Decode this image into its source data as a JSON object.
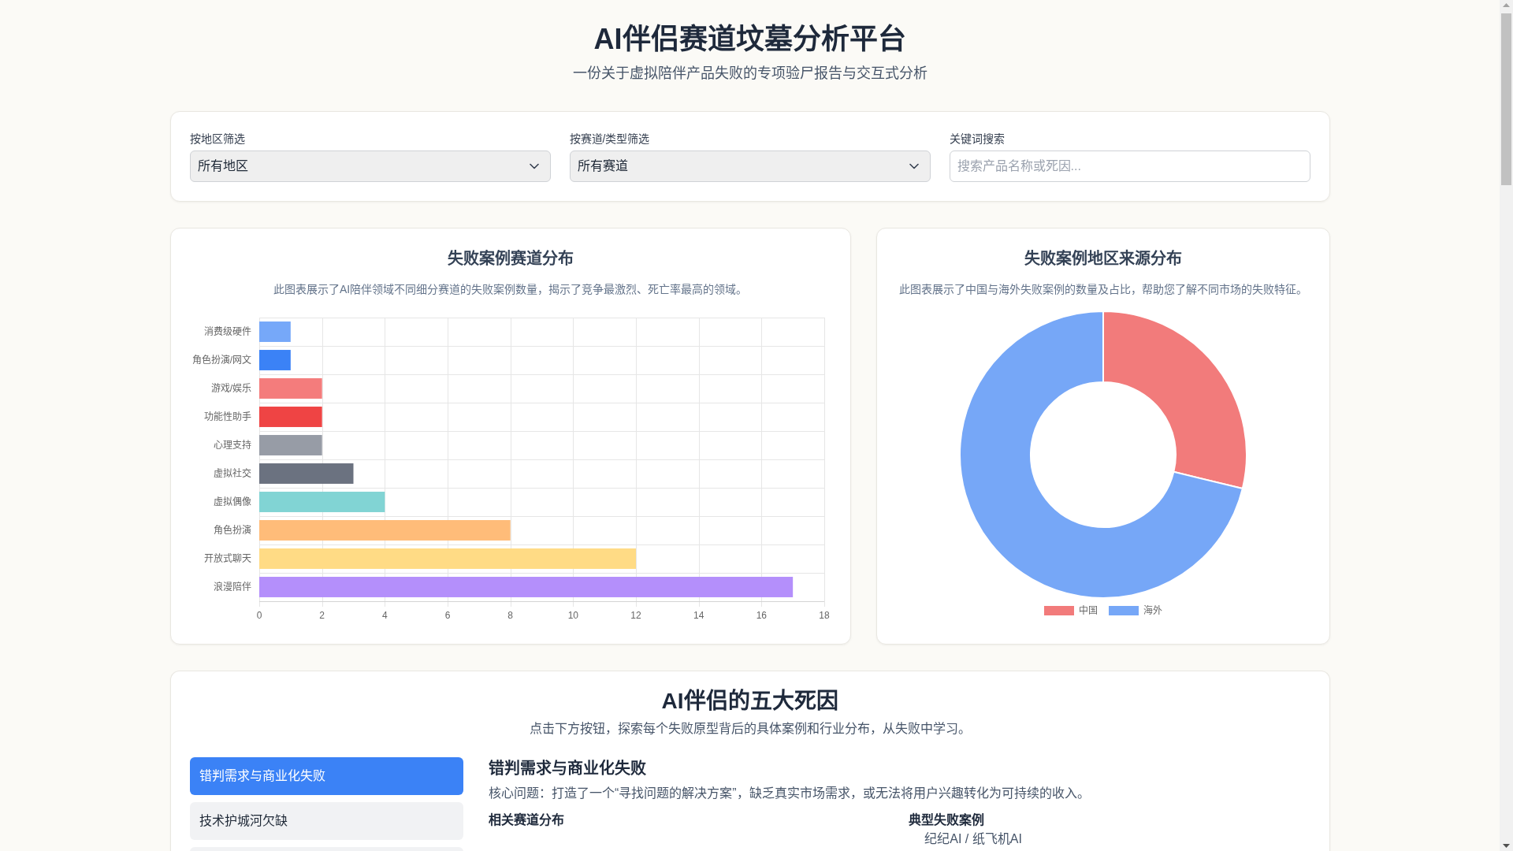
{
  "header": {
    "title": "AI伴侣赛道坟墓分析平台",
    "subtitle": "一份关于虚拟陪伴产品失败的专项验尸报告与交互式分析"
  },
  "filters": [
    {
      "kind": "dropdown",
      "label": "按地区筛选",
      "value": "所有地区"
    },
    {
      "kind": "dropdown",
      "label": "按赛道/类型筛选",
      "value": "所有赛道"
    },
    {
      "kind": "search",
      "label": "关键词搜索",
      "placeholder": "搜索产品名称或死因..."
    }
  ],
  "track_chart": {
    "title": "失败案例赛道分布",
    "description": "此图表展示了AI陪伴领域不同细分赛道的失败案例数量，揭示了竞争最激烈、死亡率最高的领域。",
    "chart_data": {
      "type": "bar",
      "orientation": "horizontal",
      "grid": true,
      "categories": [
        "消费级硬件",
        "角色扮演/网文",
        "游戏/娱乐",
        "功能性助手",
        "心理支持",
        "虚拟社交",
        "虚拟偶像",
        "角色扮演",
        "开放式聊天",
        "浪漫陪伴"
      ],
      "values": [
        1,
        1,
        2,
        2,
        2,
        3,
        4,
        8,
        12,
        17
      ],
      "colors": [
        "#76a8f9",
        "#3b82f6",
        "#f47c7c",
        "#ef4444",
        "#979ca6",
        "#6b7280",
        "#81d4d4",
        "#ffbc79",
        "#ffdb85",
        "#b48ffb"
      ],
      "xlim": [
        0,
        18
      ],
      "xticks": [
        0,
        2,
        4,
        6,
        8,
        10,
        12,
        14,
        16,
        18
      ]
    }
  },
  "region_chart": {
    "title": "失败案例地区来源分布",
    "description": "此图表展示了中国与海外失败案例的数量及占比，帮助您了解不同市场的失败特征。",
    "legend": [
      {
        "label": "中国",
        "color": "#f27b7b"
      },
      {
        "label": "海外",
        "color": "#76a7f7"
      }
    ]
  },
  "causes": {
    "title": "AI伴侣的五大死因",
    "subtitle": "点击下方按钮，探索每个失败原型背后的具体案例和行业分布，从失败中学习。",
    "tabs": [
      {
        "label": "错判需求与商业化失败",
        "selected": true
      },
      {
        "label": "技术护城河欠缺",
        "selected": false
      },
      {
        "selected": false
      }
    ],
    "detail": {
      "title": "错判需求与商业化失败",
      "summary": "核心问题：打造了一个“寻找问题的解决方案”，缺乏真实市场需求，或无法将用户兴趣转化为可持续的收入。",
      "sections": [
        {
          "title": "相关赛道分布"
        },
        {
          "title": "典型失败案例",
          "items": [
            "纪纪AI / 纸飞机AI"
          ]
        }
      ]
    }
  }
}
